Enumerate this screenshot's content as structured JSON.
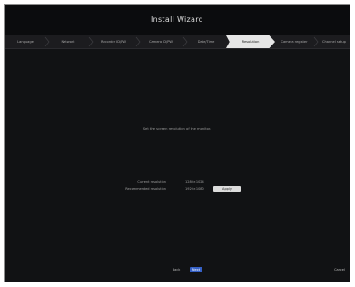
{
  "window": {
    "title": "Install Wizard"
  },
  "steps": [
    {
      "label": "Language",
      "active": false
    },
    {
      "label": "Network",
      "active": false
    },
    {
      "label": "Recorder ID/PW",
      "active": false
    },
    {
      "label": "Camera ID/PW",
      "active": false
    },
    {
      "label": "Date/Time",
      "active": false
    },
    {
      "label": "Resolution",
      "active": true
    },
    {
      "label": "Camera register",
      "active": false
    },
    {
      "label": "Channel setup",
      "active": false
    }
  ],
  "content": {
    "instruction": "Set the screen resolution of the monitor.",
    "current_resolution_label": "Current resolution",
    "current_resolution_value": "1280×1024",
    "recommended_resolution_label": "Recommended resolution",
    "recommended_resolution_value": "1920×1080",
    "apply_label": "Apply"
  },
  "footer": {
    "back_label": "Back",
    "next_label": "Next",
    "cancel_label": "Cancel"
  },
  "colors": {
    "background": "#111214",
    "active_step": "#e6e6e6",
    "primary_button": "#3560c6"
  }
}
